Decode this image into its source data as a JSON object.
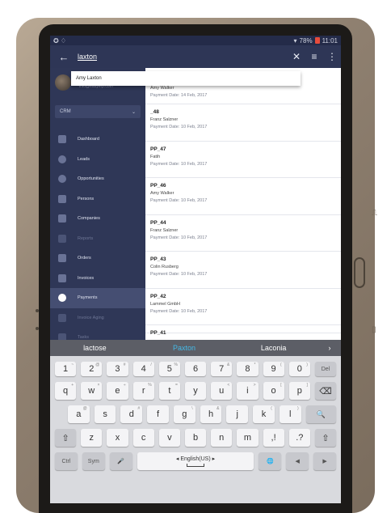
{
  "status": {
    "battery": "78%",
    "time": "11:01"
  },
  "topbar": {
    "search_value": "laxton"
  },
  "autocomplete": {
    "suggestion": "Amy Laxton"
  },
  "sidebar": {
    "email": "info@easyerp.com",
    "module": "CRM",
    "items": [
      {
        "label": "Dashboard",
        "icon": "chart-icon",
        "state": "normal"
      },
      {
        "label": "Leads",
        "icon": "target-icon",
        "state": "normal"
      },
      {
        "label": "Opportunities",
        "icon": "dollar-icon",
        "state": "normal"
      },
      {
        "label": "Persons",
        "icon": "persons-icon",
        "state": "normal"
      },
      {
        "label": "Companies",
        "icon": "building-icon",
        "state": "normal"
      },
      {
        "label": "Reports",
        "icon": "bar-chart-icon",
        "state": "dim"
      },
      {
        "label": "Orders",
        "icon": "cart-icon",
        "state": "normal"
      },
      {
        "label": "Invoices",
        "icon": "invoice-icon",
        "state": "normal"
      },
      {
        "label": "Payments",
        "icon": "dollar-circle-icon",
        "state": "active"
      },
      {
        "label": "Invoice Aging",
        "icon": "aging-icon",
        "state": "dim"
      },
      {
        "label": "Tasks",
        "icon": "tasks-icon",
        "state": "dim"
      }
    ]
  },
  "payments": [
    {
      "title": "",
      "name": "Amy Walker",
      "date": "Payment Date: 14 Feb, 2017"
    },
    {
      "title": "_48",
      "name": "Franz Salzner",
      "date": "Payment Date: 10 Feb, 2017"
    },
    {
      "title": "PP_47",
      "name": "Fatih",
      "date": "Payment Date: 10 Feb, 2017"
    },
    {
      "title": "PP_46",
      "name": "Amy Walker",
      "date": "Payment Date: 10 Feb, 2017"
    },
    {
      "title": "PP_44",
      "name": "Franz Salzner",
      "date": "Payment Date: 10 Feb, 2017"
    },
    {
      "title": "PP_43",
      "name": "Colin Rusberg",
      "date": "Payment Date: 10 Feb, 2017"
    },
    {
      "title": "PP_42",
      "name": "Lammel GmbH",
      "date": "Payment Date: 10 Feb, 2017"
    },
    {
      "title": "PP_41",
      "name": "",
      "date": ""
    }
  ],
  "keyboard": {
    "suggestions": [
      "lactose",
      "Paxton",
      "Laconia"
    ],
    "suggestion_more": "›",
    "num_row": [
      {
        "k": "1",
        "s": "~"
      },
      {
        "k": "2",
        "s": "@"
      },
      {
        "k": "3",
        "s": "#"
      },
      {
        "k": "4",
        "s": "/"
      },
      {
        "k": "5",
        "s": "%"
      },
      {
        "k": "6",
        "s": ""
      },
      {
        "k": "7",
        "s": "&"
      },
      {
        "k": "8",
        "s": "*"
      },
      {
        "k": "9",
        "s": "("
      },
      {
        "k": "0",
        "s": ")"
      },
      {
        "k": "Del",
        "s": ""
      }
    ],
    "row1": [
      {
        "k": "q",
        "s": "+"
      },
      {
        "k": "w",
        "s": "×"
      },
      {
        "k": "e",
        "s": "÷"
      },
      {
        "k": "r",
        "s": "%"
      },
      {
        "k": "t",
        "s": "="
      },
      {
        "k": "y",
        "s": ""
      },
      {
        "k": "u",
        "s": "<"
      },
      {
        "k": "i",
        "s": ">"
      },
      {
        "k": "o",
        "s": "["
      },
      {
        "k": "p",
        "s": "]"
      },
      {
        "k": "⌫",
        "s": ""
      }
    ],
    "row2": [
      {
        "k": "a",
        "s": "@"
      },
      {
        "k": "s",
        "s": ""
      },
      {
        "k": "d",
        "s": "#"
      },
      {
        "k": "f",
        "s": ""
      },
      {
        "k": "g",
        "s": "\\"
      },
      {
        "k": "h",
        "s": "&"
      },
      {
        "k": "j",
        "s": ""
      },
      {
        "k": "k",
        "s": "("
      },
      {
        "k": "l",
        "s": ")"
      },
      {
        "k": "🔍",
        "s": ""
      }
    ],
    "row3": [
      {
        "k": "⇧",
        "s": ""
      },
      {
        "k": "z",
        "s": ""
      },
      {
        "k": "x",
        "s": ""
      },
      {
        "k": "c",
        "s": ""
      },
      {
        "k": "v",
        "s": ""
      },
      {
        "k": "b",
        "s": ""
      },
      {
        "k": "n",
        "s": ""
      },
      {
        "k": "m",
        "s": ""
      },
      {
        "k": ",!",
        "s": ""
      },
      {
        "k": ".?",
        "s": ""
      },
      {
        "k": "⇧",
        "s": ""
      }
    ],
    "bottom": {
      "ctrl": "Ctrl",
      "sym": "Sym",
      "mic": "🎤",
      "language": "◂ English(US) ▸",
      "globe": "🌐",
      "left": "◀",
      "right": "▶"
    }
  }
}
